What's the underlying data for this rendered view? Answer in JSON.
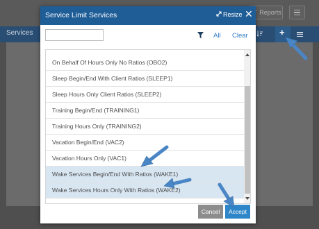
{
  "background": {
    "toolbar": {
      "reports_label": "Reports",
      "reports_icon": "chart-icon",
      "menu_icon": "hamburger-icon"
    },
    "header": {
      "title": "Services",
      "icons": [
        "sort-icon",
        "plus-icon",
        "hamburger-icon"
      ]
    }
  },
  "modal": {
    "title": "Service Limit Services",
    "resize_label": "Resize",
    "resize_icon": "resize-icon",
    "close_icon": "close-icon",
    "filter": {
      "search_value": "",
      "search_placeholder": "",
      "filter_icon": "filter-icon",
      "all_label": "All",
      "clear_label": "Clear"
    },
    "items": [
      {
        "label": "On Behalf Of Hours Only No Ratios (OBO2)",
        "selected": false
      },
      {
        "label": "Sleep Begin/End With Client Ratios (SLEEP1)",
        "selected": false
      },
      {
        "label": "Sleep Hours Only Client Ratios (SLEEP2)",
        "selected": false
      },
      {
        "label": "Training Begin/End (TRAINING1)",
        "selected": false
      },
      {
        "label": "Training Hours Only (TRAINING2)",
        "selected": false
      },
      {
        "label": "Vacation Begin/End (VAC2)",
        "selected": false
      },
      {
        "label": "Vacation Hours Only (VAC1)",
        "selected": false
      },
      {
        "label": "Wake Services Begin/End With Ratios (WAKE1)",
        "selected": true
      },
      {
        "label": "Wake Services Hours Only With Ratios (WAKE2)",
        "selected": true
      }
    ],
    "cancel_label": "Cancel",
    "accept_label": "Accept"
  },
  "colors": {
    "header_blue": "#1f5d97",
    "accept_blue": "#2e86c8",
    "selected_row": "#d8e6f2",
    "link_blue": "#2f7ac6",
    "arrow_blue": "#4a86c5"
  }
}
